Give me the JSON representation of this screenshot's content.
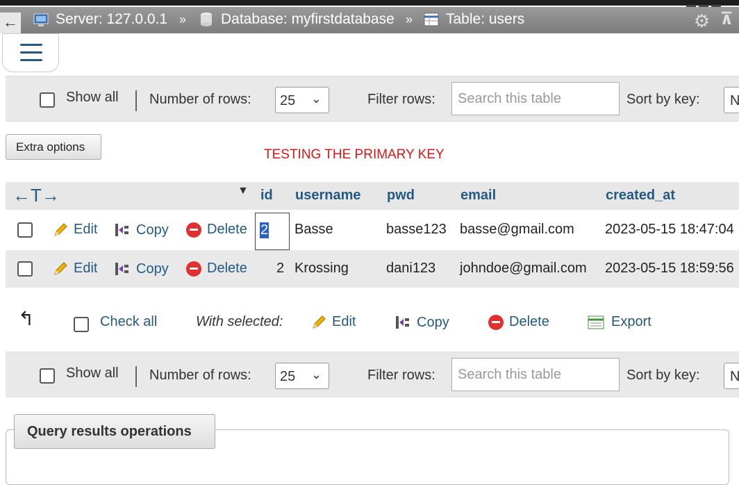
{
  "navbar": {
    "back_label": "←",
    "server": "Server: 127.0.0.1",
    "database": "Database: myfirstdatabase",
    "table": "Table: users",
    "separator": "»"
  },
  "nav_top": {
    "show_all": "Show all",
    "rows_label": "Number of rows:",
    "rows_value": "25",
    "filter_label": "Filter rows:",
    "search_placeholder": "Search this table",
    "sort_label": "Sort by key:",
    "sort_value": "N"
  },
  "extra_options": "Extra options",
  "annotation": "TESTING THE PRIMARY KEY",
  "table": {
    "columns": [
      "id",
      "username",
      "pwd",
      "email",
      "created_at"
    ],
    "actions": {
      "edit": "Edit",
      "copy": "Copy",
      "delete": "Delete"
    },
    "rows": [
      {
        "id": "2",
        "username": "Basse",
        "pwd": "basse123",
        "email": "basse@gmail.com",
        "created_at": "2023-05-15 18:47:04"
      },
      {
        "id": "2",
        "username": "Krossing",
        "pwd": "dani123",
        "email": "johndoe@gmail.com",
        "created_at": "2023-05-15 18:59:56"
      }
    ]
  },
  "bulk": {
    "check_all": "Check all",
    "with_selected": "With selected:",
    "edit": "Edit",
    "copy": "Copy",
    "delete": "Delete",
    "export": "Export"
  },
  "nav_bottom": {
    "show_all": "Show all",
    "rows_label": "Number of rows:",
    "rows_value": "25",
    "filter_label": "Filter rows:",
    "search_placeholder": "Search this table",
    "sort_label": "Sort by key:",
    "sort_value": "N"
  },
  "query_results_operations": "Query results operations",
  "colors": {
    "link": "#235a81",
    "annotation": "#e01414",
    "delete": "#e03030"
  }
}
